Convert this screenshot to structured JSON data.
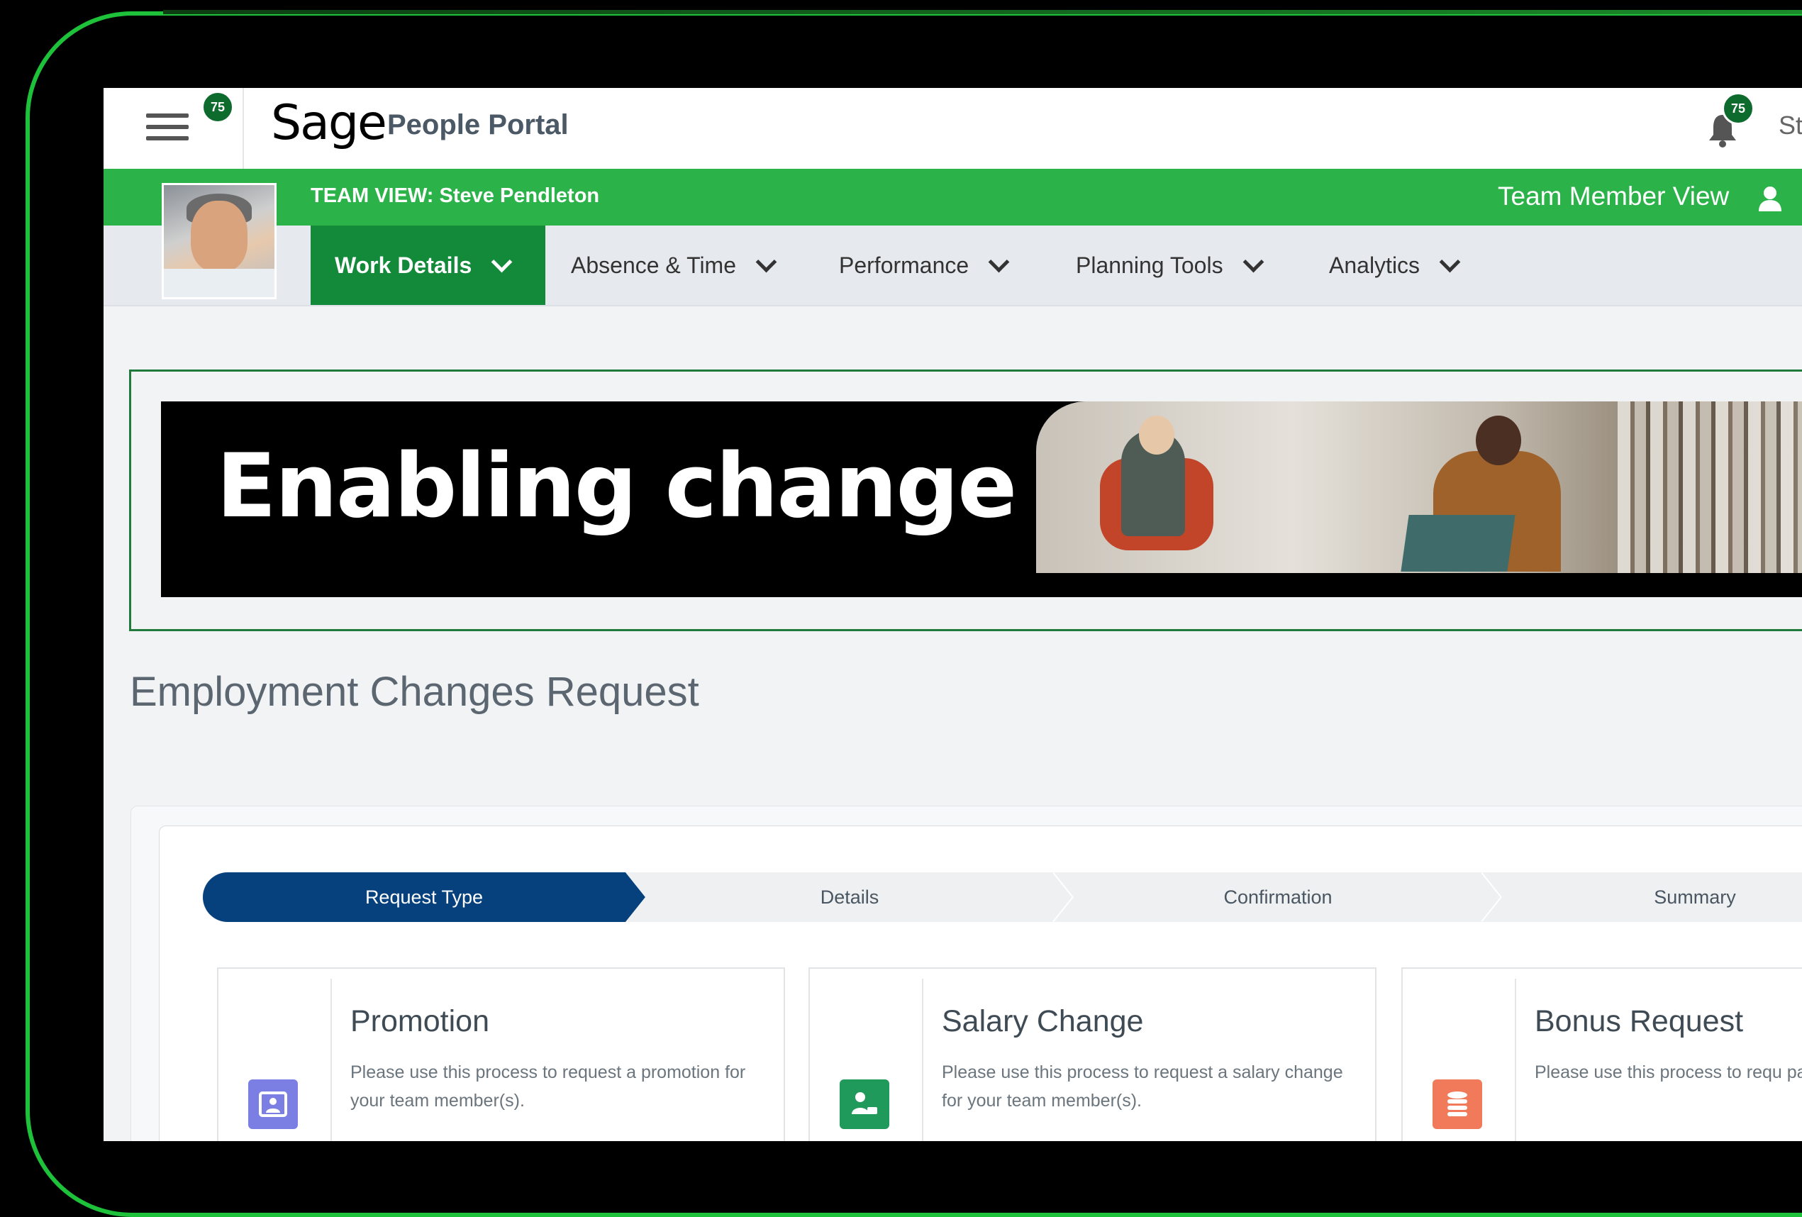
{
  "header": {
    "logo": "Sage",
    "portal_title": "People Portal",
    "menu_badge": "75",
    "notification_badge": "75",
    "user_name_visible": "St"
  },
  "team_bar": {
    "title": "TEAM VIEW: Steve Pendleton",
    "view_toggle": "Team Member View"
  },
  "nav": {
    "items": [
      {
        "label": "Work Details"
      },
      {
        "label": "Absence & Time"
      },
      {
        "label": "Performance"
      },
      {
        "label": "Planning Tools"
      },
      {
        "label": "Analytics"
      }
    ],
    "active_index": 0
  },
  "banner": {
    "headline": "Enabling change"
  },
  "page": {
    "title": "Employment Changes Request"
  },
  "stepper": {
    "steps": [
      "Request Type",
      "Details",
      "Confirmation",
      "Summary"
    ],
    "active_index": 0
  },
  "tiles": [
    {
      "title": "Promotion",
      "description": "Please use this process to request a promotion for your team member(s).",
      "icon": "promotion-icon",
      "color": "#7b7fe3"
    },
    {
      "title": "Salary Change",
      "description": "Please use this process to request a salary change for your team member(s).",
      "icon": "salary-icon",
      "color": "#1f9a5a"
    },
    {
      "title": "Bonus Request",
      "description": "Please use this process to requ payment for your team membe",
      "icon": "coins-icon",
      "color": "#f07a5a"
    }
  ],
  "colors": {
    "brand_green": "#2bb34a",
    "nav_active": "#128a3a",
    "stepper_active": "#06417e",
    "frame_green": "#1ec23a"
  }
}
